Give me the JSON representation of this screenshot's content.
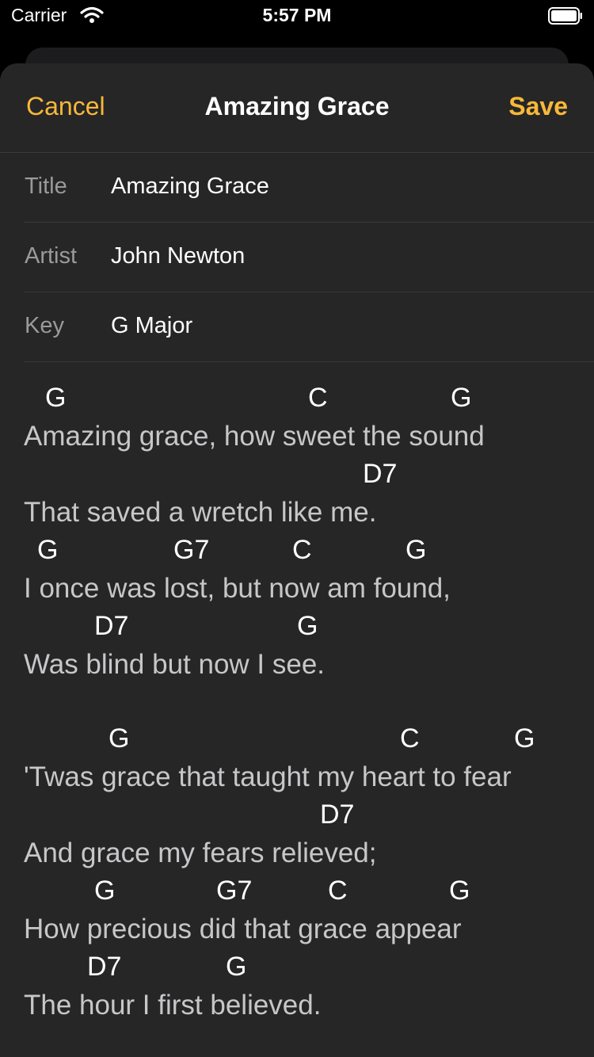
{
  "status_bar": {
    "carrier": "Carrier",
    "time": "5:57 PM"
  },
  "navbar": {
    "cancel_label": "Cancel",
    "title": "Amazing Grace",
    "save_label": "Save"
  },
  "form": {
    "title_label": "Title",
    "title_value": "Amazing Grace",
    "artist_label": "Artist",
    "artist_value": "John Newton",
    "key_label": "Key",
    "key_value": "G Major"
  },
  "lyrics": {
    "stanza1": {
      "c1": [
        "G",
        "C",
        "G"
      ],
      "l1": "Amazing grace, how sweet the sound",
      "c2": [
        "D7"
      ],
      "l2": "That saved a wretch like me.",
      "c3": [
        "G",
        "G7",
        "C",
        "G"
      ],
      "l3": "I once was lost, but now am found,",
      "c4": [
        "D7",
        "G"
      ],
      "l4": "Was blind but now I see."
    },
    "stanza2": {
      "c1": [
        "G",
        "C",
        "G"
      ],
      "l1": "'Twas grace that taught my heart to fear",
      "c2": [
        "D7"
      ],
      "l2": "And grace my fears relieved;",
      "c3": [
        "G",
        "G7",
        "C",
        "G"
      ],
      "l3": "How precious did that grace appear",
      "c4": [
        "D7",
        "G"
      ],
      "l4": "The hour I first believed."
    }
  },
  "colors": {
    "accent": "#f8b83a",
    "sheet_background": "#262626",
    "separator": "#3a3a3c"
  }
}
